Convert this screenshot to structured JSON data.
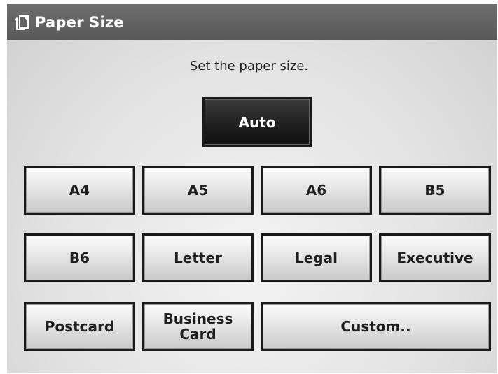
{
  "title": "Paper Size",
  "title_icon": "paper-size-icon",
  "instruction": "Set the paper size.",
  "auto_label": "Auto",
  "sizes": {
    "a4": "A4",
    "a5": "A5",
    "a6": "A6",
    "b5": "B5",
    "b6": "B6",
    "letter": "Letter",
    "legal": "Legal",
    "executive": "Executive",
    "postcard": "Postcard",
    "business_card": "Business\nCard",
    "custom": "Custom.."
  },
  "colors": {
    "titlebar": "#5f5f5f",
    "selected_button": "#1e1e1e",
    "button": "#d9d9d9"
  }
}
